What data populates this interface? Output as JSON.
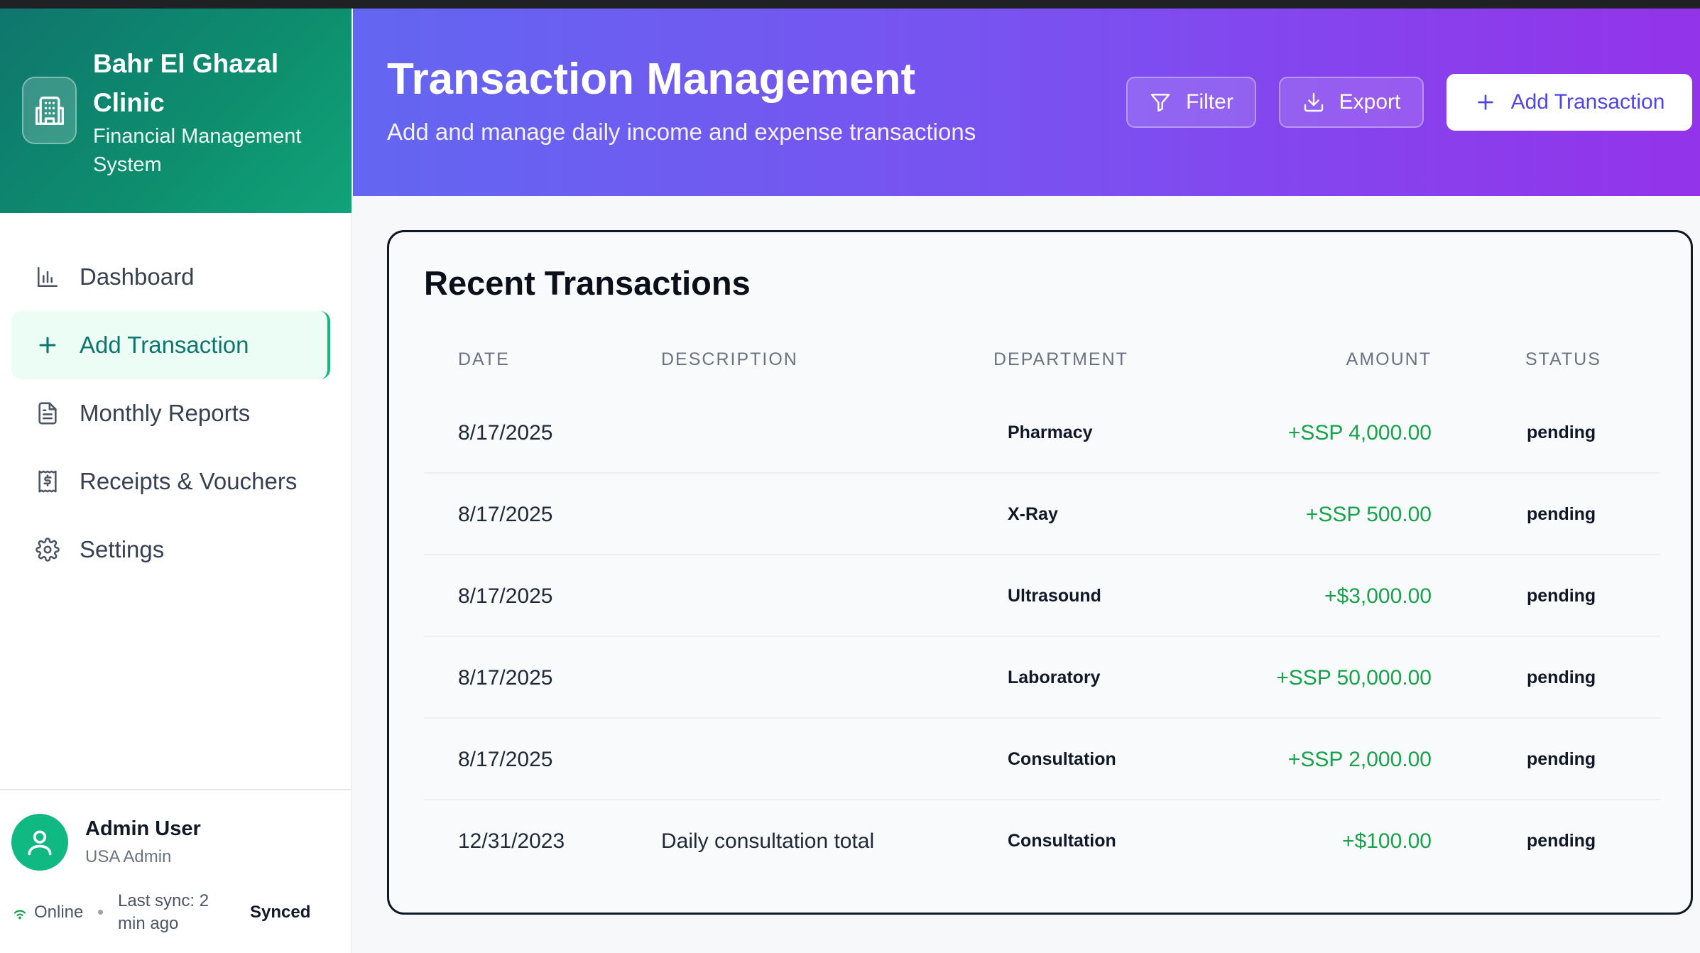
{
  "brand": {
    "title": "Bahr El Ghazal Clinic",
    "subtitle": "Financial Management System",
    "logo_icon": "building-icon"
  },
  "nav": {
    "items": [
      {
        "label": "Dashboard",
        "icon": "bar-chart-icon"
      },
      {
        "label": "Add Transaction",
        "icon": "plus-icon",
        "active": true
      },
      {
        "label": "Monthly Reports",
        "icon": "document-icon"
      },
      {
        "label": "Receipts & Vouchers",
        "icon": "receipt-icon"
      },
      {
        "label": "Settings",
        "icon": "gear-icon"
      }
    ]
  },
  "user": {
    "name": "Admin User",
    "role": "USA Admin",
    "online": "Online",
    "last_sync": "Last sync: 2 min ago",
    "sync_status": "Synced"
  },
  "header": {
    "title": "Transaction Management",
    "subtitle": "Add and manage daily income and expense transactions",
    "filter_label": "Filter",
    "export_label": "Export",
    "add_label": "Add Transaction"
  },
  "card": {
    "title": "Recent Transactions",
    "columns": {
      "date": "DATE",
      "description": "DESCRIPTION",
      "department": "DEPARTMENT",
      "amount": "AMOUNT",
      "status": "STATUS"
    },
    "rows": [
      {
        "date": "8/17/2025",
        "description": "",
        "department": "Pharmacy",
        "amount": "+SSP 4,000.00",
        "status": "pending"
      },
      {
        "date": "8/17/2025",
        "description": "",
        "department": "X-Ray",
        "amount": "+SSP 500.00",
        "status": "pending"
      },
      {
        "date": "8/17/2025",
        "description": "",
        "department": "Ultrasound",
        "amount": "+$3,000.00",
        "status": "pending"
      },
      {
        "date": "8/17/2025",
        "description": "",
        "department": "Laboratory",
        "amount": "+SSP 50,000.00",
        "status": "pending"
      },
      {
        "date": "8/17/2025",
        "description": "",
        "department": "Consultation",
        "amount": "+SSP 2,000.00",
        "status": "pending"
      },
      {
        "date": "12/31/2023",
        "description": "Daily consultation total",
        "department": "Consultation",
        "amount": "+$100.00",
        "status": "pending"
      }
    ]
  },
  "colors": {
    "brand_green": "#0f766e",
    "header_start": "#6366f1",
    "header_end": "#9333ea",
    "income_green": "#16a34a"
  }
}
